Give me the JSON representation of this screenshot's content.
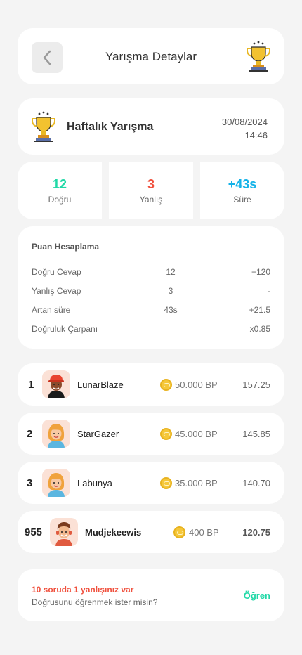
{
  "header": {
    "title": "Yarışma Detaylar",
    "back_icon": "chevron-left-icon",
    "trophy_icon": "trophy-icon"
  },
  "competition": {
    "name": "Haftalık Yarışma",
    "date": "30/08/2024",
    "time": "14:46"
  },
  "stats": {
    "correct": {
      "value": "12",
      "label": "Doğru",
      "color": "#1fd8a6"
    },
    "wrong": {
      "value": "3",
      "label": "Yanlış",
      "color": "#f0513e"
    },
    "time": {
      "value": "+43s",
      "label": "Süre",
      "color": "#13b2e8"
    }
  },
  "scoring": {
    "title": "Puan Hesaplama",
    "rows": [
      {
        "label": "Doğru Cevap",
        "value": "12",
        "points": "+120"
      },
      {
        "label": "Yanlış Cevap",
        "value": "3",
        "points": "-"
      },
      {
        "label": "Artan süre",
        "value": "43s",
        "points": "+21.5"
      },
      {
        "label": "Doğruluk Çarpanı",
        "value": "",
        "points": "x0.85"
      }
    ]
  },
  "leaderboard": [
    {
      "rank": "1",
      "name": "LunarBlaze",
      "bp": "50.000 BP",
      "score": "157.25"
    },
    {
      "rank": "2",
      "name": "StarGazer",
      "bp": "45.000 BP",
      "score": "145.85"
    },
    {
      "rank": "3",
      "name": "Labunya",
      "bp": "35.000 BP",
      "score": "140.70"
    },
    {
      "rank": "955",
      "name": "Mudjekeewis",
      "bp": "400 BP",
      "score": "120.75"
    }
  ],
  "cta": {
    "title": "10 soruda 1 yanlışınız var",
    "subtitle": "Doğrusunu öğrenmek ister misin?",
    "link": "Öğren",
    "link_color": "#1fd8a6"
  }
}
